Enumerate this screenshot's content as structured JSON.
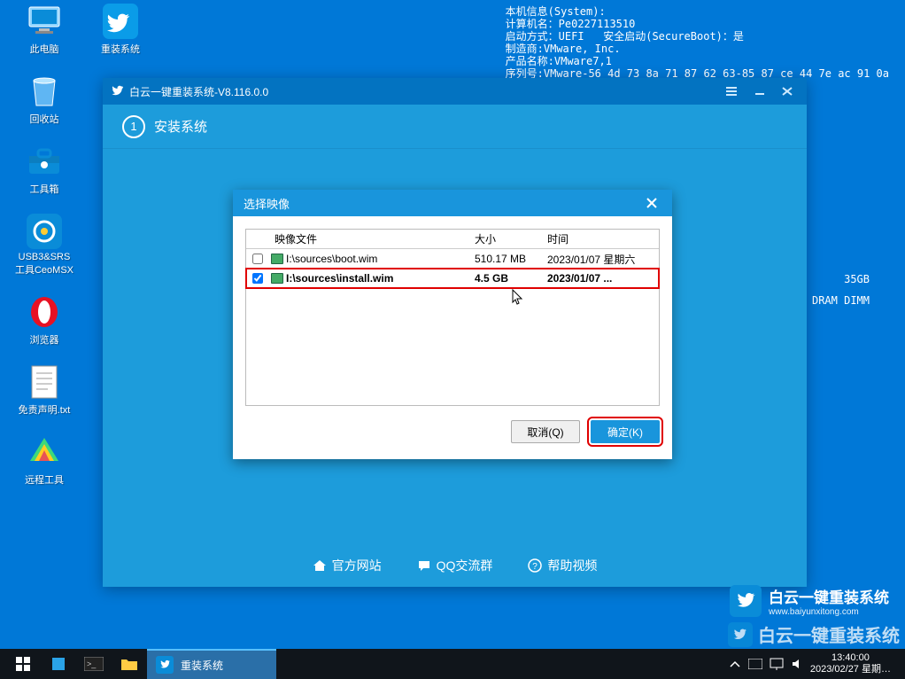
{
  "desktop": {
    "icons": [
      {
        "name": "this-pc",
        "label": "此电脑"
      },
      {
        "name": "reinstall",
        "label": "重装系统"
      },
      {
        "name": "recycle",
        "label": "回收站"
      },
      {
        "name": "toolbox",
        "label": "工具箱"
      },
      {
        "name": "usb3",
        "label": "USB3&SRS\n工具CeoMSX"
      },
      {
        "name": "browser",
        "label": "浏览器"
      },
      {
        "name": "disclaimer",
        "label": "免责声明.txt"
      },
      {
        "name": "remote",
        "label": "远程工具"
      }
    ]
  },
  "sysinfo": "本机信息(System):\n计算机名：Pe0227113510\n启动方式：UEFI   安全启动(SecureBoot)：是\n制造商:VMware, Inc.\n产品名称:VMware7,1\n序列号:VMware-56 4d 73 8a 71 87 62 63-85 87 ce 44 7e ac 91 0a",
  "hidden_info": {
    "line1": "35GB",
    "line2": "n  DRAM DIMM"
  },
  "main_window": {
    "title": "白云一键重装系统-V8.116.0.0",
    "step_label": "安装系统",
    "step_num": "1",
    "footer": {
      "site": "官方网站",
      "qq": "QQ交流群",
      "help": "帮助视频"
    }
  },
  "dialog": {
    "title": "选择映像",
    "headers": {
      "file": "映像文件",
      "size": "大小",
      "time": "时间"
    },
    "rows": [
      {
        "checked": false,
        "path": "I:\\sources\\boot.wim",
        "size": "510.17 MB",
        "time": "2023/01/07 星期六"
      },
      {
        "checked": true,
        "path": "I:\\sources\\install.wim",
        "size": "4.5 GB",
        "time": "2023/01/07 ..."
      }
    ],
    "buttons": {
      "cancel": "取消(Q)",
      "ok": "确定(K)"
    }
  },
  "brand": {
    "text": "白云一键重装系统",
    "url": "www.baiyunxitong.com"
  },
  "watermark": "白云一键重装系统",
  "taskbar": {
    "running": "重装系统",
    "time": "13:40:00",
    "date": "2023/02/27 星期…"
  }
}
